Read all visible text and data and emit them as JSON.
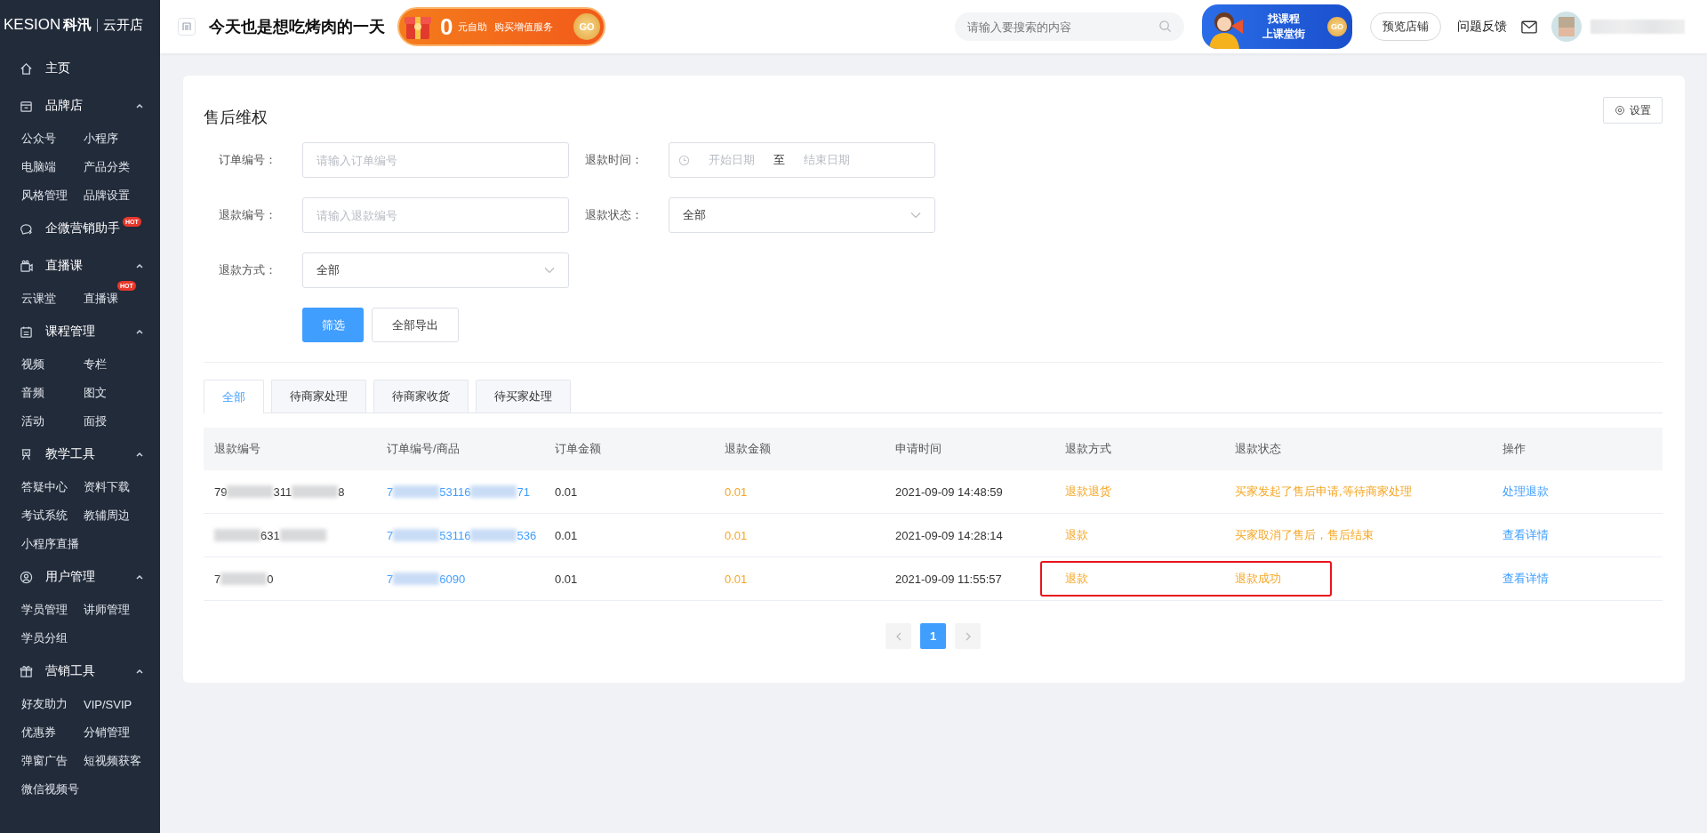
{
  "logo": {
    "brand": "KESION",
    "brand_cn": "科汛",
    "product": "云开店"
  },
  "topbar": {
    "shop_name": "今天也是想吃烤肉的一天",
    "promo": {
      "amount": "0",
      "unit": "元自助",
      "text": "购买增值服务",
      "go": "GO"
    },
    "search": {
      "placeholder": "请输入要搜索的内容"
    },
    "course_banner": {
      "line1": "找课程",
      "line2": "上课堂街",
      "go": "GO"
    },
    "preview_button": "预览店铺",
    "feedback": "问题反馈"
  },
  "sidebar": [
    {
      "kind": "link",
      "label": "主页"
    },
    {
      "kind": "group",
      "label": "品牌店",
      "expanded": true,
      "items": [
        {
          "label": "公众号"
        },
        {
          "label": "小程序"
        },
        {
          "label": "电脑端"
        },
        {
          "label": "产品分类"
        },
        {
          "label": "风格管理"
        },
        {
          "label": "品牌设置"
        }
      ]
    },
    {
      "kind": "link",
      "label": "企微营销助手",
      "badge": "HOT"
    },
    {
      "kind": "group",
      "label": "直播课",
      "expanded": true,
      "items": [
        {
          "label": "云课堂"
        },
        {
          "label": "直播课",
          "badge": "HOT"
        }
      ]
    },
    {
      "kind": "group",
      "label": "课程管理",
      "expanded": true,
      "items": [
        {
          "label": "视频"
        },
        {
          "label": "专栏"
        },
        {
          "label": "音频"
        },
        {
          "label": "图文"
        },
        {
          "label": "活动"
        },
        {
          "label": "面授"
        }
      ]
    },
    {
      "kind": "group",
      "label": "教学工具",
      "expanded": true,
      "items": [
        {
          "label": "答疑中心"
        },
        {
          "label": "资料下载"
        },
        {
          "label": "考试系统"
        },
        {
          "label": "教辅周边"
        },
        {
          "label": "小程序直播"
        }
      ]
    },
    {
      "kind": "group",
      "label": "用户管理",
      "expanded": true,
      "items": [
        {
          "label": "学员管理"
        },
        {
          "label": "讲师管理"
        },
        {
          "label": "学员分组"
        }
      ]
    },
    {
      "kind": "group",
      "label": "营销工具",
      "expanded": true,
      "items": [
        {
          "label": "好友助力"
        },
        {
          "label": "VIP/SVIP"
        },
        {
          "label": "优惠券"
        },
        {
          "label": "分销管理"
        },
        {
          "label": "弹窗广告"
        },
        {
          "label": "短视频获客"
        },
        {
          "label": "微信视频号"
        }
      ]
    }
  ],
  "page": {
    "title": "售后维权",
    "settings_button": "设置",
    "filters": [
      {
        "kind": "input",
        "label": "订单编号：",
        "placeholder": "请输入订单编号"
      },
      {
        "kind": "daterange",
        "label": "退款时间：",
        "start_placeholder": "开始日期",
        "separator": "至",
        "end_placeholder": "结束日期"
      },
      {
        "kind": "input",
        "label": "退款编号：",
        "placeholder": "请输入退款编号"
      },
      {
        "kind": "select",
        "label": "退款状态：",
        "value": "全部"
      },
      {
        "kind": "select",
        "label": "退款方式：",
        "value": "全部"
      }
    ],
    "filter_button": "筛选",
    "export_button": "全部导出",
    "tabs": [
      {
        "label": "全部",
        "selected": true
      },
      {
        "label": "待商家处理",
        "selected": false
      },
      {
        "label": "待商家收货",
        "selected": false
      },
      {
        "label": "待买家处理",
        "selected": false
      }
    ],
    "table": {
      "columns": [
        "退款编号",
        "订单编号/商品",
        "订单金额",
        "退款金额",
        "申请时间",
        "退款方式",
        "退款状态",
        "操作"
      ],
      "rows": [
        {
          "refund_no": [
            {
              "kind": "text",
              "text": "79"
            },
            {
              "kind": "blur"
            },
            {
              "kind": "text",
              "text": "311"
            },
            {
              "kind": "blur"
            },
            {
              "kind": "text",
              "text": "8"
            }
          ],
          "order_no": [
            {
              "kind": "text",
              "text": "7"
            },
            {
              "kind": "blur"
            },
            {
              "kind": "text",
              "text": "53116"
            },
            {
              "kind": "blur"
            },
            {
              "kind": "text",
              "text": "71"
            }
          ],
          "order_amount": "0.01",
          "refund_amount": "0.01",
          "time": "2021-09-09 14:48:59",
          "method": "退款退货",
          "status": "买家发起了售后申请,等待商家处理",
          "action": "处理退款",
          "highlighted": false
        },
        {
          "refund_no": [
            {
              "kind": "blur"
            },
            {
              "kind": "text",
              "text": "631"
            },
            {
              "kind": "blur"
            }
          ],
          "order_no": [
            {
              "kind": "text",
              "text": "7"
            },
            {
              "kind": "blur"
            },
            {
              "kind": "text",
              "text": "53116"
            },
            {
              "kind": "blur"
            },
            {
              "kind": "text",
              "text": "536"
            }
          ],
          "order_amount": "0.01",
          "refund_amount": "0.01",
          "time": "2021-09-09 14:28:14",
          "method": "退款",
          "status": "买家取消了售后，售后结束",
          "action": "查看详情",
          "highlighted": false
        },
        {
          "refund_no": [
            {
              "kind": "text",
              "text": "7"
            },
            {
              "kind": "blur"
            },
            {
              "kind": "text",
              "text": "0"
            }
          ],
          "order_no": [
            {
              "kind": "text",
              "text": "7"
            },
            {
              "kind": "blur"
            },
            {
              "kind": "text",
              "text": "6090"
            }
          ],
          "order_amount": "0.01",
          "refund_amount": "0.01",
          "time": "2021-09-09 11:55:57",
          "method": "退款",
          "status": "退款成功",
          "action": "查看详情",
          "highlighted": true
        }
      ]
    },
    "pagination": {
      "pages": [
        {
          "label": "1",
          "selected": true
        }
      ]
    }
  }
}
